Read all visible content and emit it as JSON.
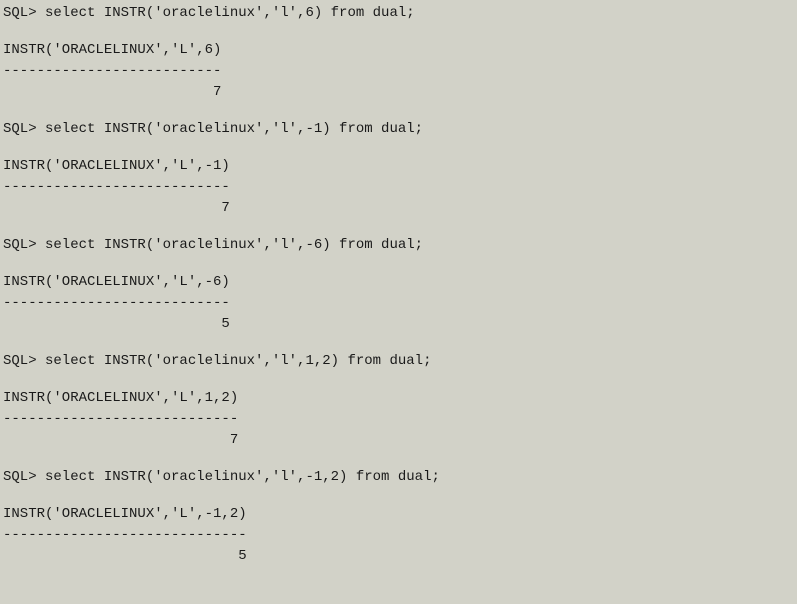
{
  "blocks": [
    {
      "prompt": "SQL> select INSTR('oraclelinux','l',6) from dual;",
      "header": "INSTR('ORACLELINUX','L',6)",
      "dashes": "--------------------------",
      "value": "                         7"
    },
    {
      "prompt": "SQL> select INSTR('oraclelinux','l',-1) from dual;",
      "header": "INSTR('ORACLELINUX','L',-1)",
      "dashes": "---------------------------",
      "value": "                          7"
    },
    {
      "prompt": "SQL> select INSTR('oraclelinux','l',-6) from dual;",
      "header": "INSTR('ORACLELINUX','L',-6)",
      "dashes": "---------------------------",
      "value": "                          5"
    },
    {
      "prompt": "SQL> select INSTR('oraclelinux','l',1,2) from dual;",
      "header": "INSTR('ORACLELINUX','L',1,2)",
      "dashes": "----------------------------",
      "value": "                           7"
    },
    {
      "prompt": "SQL> select INSTR('oraclelinux','l',-1,2) from dual;",
      "header": "INSTR('ORACLELINUX','L',-1,2)",
      "dashes": "-----------------------------",
      "value": "                            5"
    }
  ]
}
